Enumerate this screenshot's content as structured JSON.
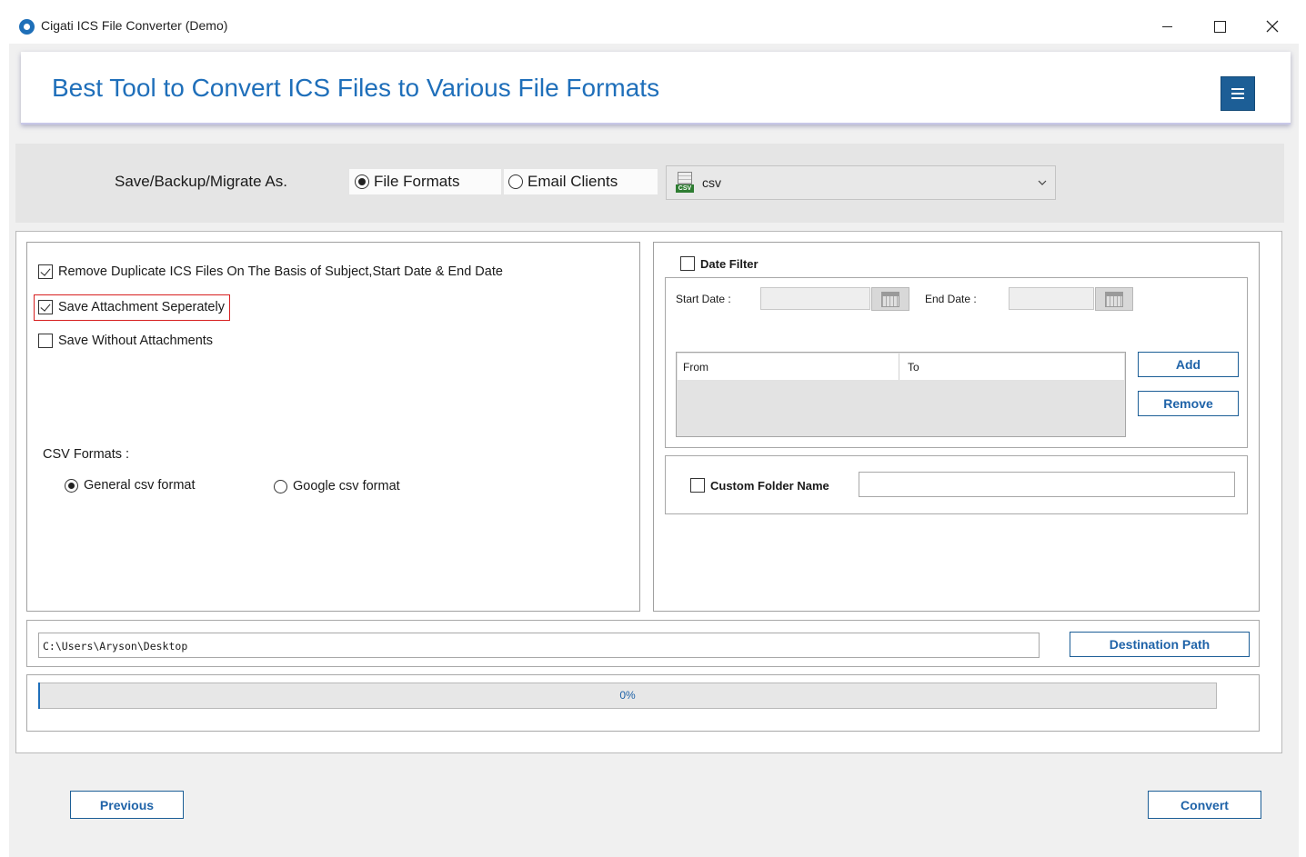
{
  "window": {
    "title": "Cigati ICS File Converter (Demo)",
    "controls": [
      "minimize",
      "maximize",
      "close"
    ]
  },
  "banner": {
    "title": "Best Tool to Convert ICS Files to Various File Formats",
    "menu_icon": "hamburger-menu-icon"
  },
  "save_as": {
    "label": "Save/Backup/Migrate As.",
    "options": [
      {
        "label": "File Formats",
        "selected": true
      },
      {
        "label": "Email Clients",
        "selected": false
      }
    ],
    "format_select": {
      "value": "csv",
      "icon": "csv-file-icon",
      "icon_text": "CSV"
    }
  },
  "options": {
    "remove_duplicates": {
      "label": "Remove Duplicate ICS Files On The Basis of Subject,Start Date & End Date",
      "checked": true
    },
    "save_attachment": {
      "label": "Save Attachment Seperately",
      "checked": true,
      "highlighted": true,
      "highlight_color": "#d72020"
    },
    "save_without_attachments": {
      "label": "Save Without Attachments",
      "checked": false
    }
  },
  "csv_formats": {
    "label": "CSV Formats :",
    "options": [
      {
        "label": "General csv  format",
        "selected": true
      },
      {
        "label": "Google csv  format",
        "selected": false
      }
    ]
  },
  "date_filter": {
    "label": "Date Filter",
    "checked": false,
    "start_label": "Start Date :",
    "end_label": "End Date :",
    "start_value": "",
    "end_value": "",
    "table_headers": [
      "From",
      "To"
    ],
    "add_label": "Add",
    "remove_label": "Remove"
  },
  "custom_folder": {
    "label": "Custom Folder Name",
    "checked": false,
    "value": ""
  },
  "destination": {
    "path": "C:\\Users\\Aryson\\Desktop",
    "button_label": "Destination Path"
  },
  "progress": {
    "percent": 0,
    "label": "0%"
  },
  "footer": {
    "previous_label": "Previous",
    "convert_label": "Convert"
  },
  "colors": {
    "accent": "#1f6fba",
    "button_border": "#1c5e96",
    "highlight": "#d72020"
  }
}
